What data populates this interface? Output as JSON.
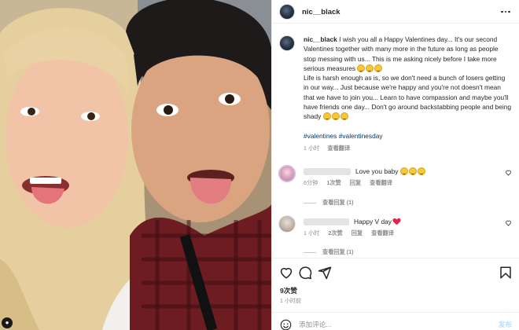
{
  "post": {
    "username": "nic__black",
    "caption": {
      "username": "nic__black",
      "paragraph1": "I wish you all a Happy Valentines day... It's our second Valentines together with many more in the future as long as people stop messing with us... This is me asking nicely before I take more serious measures",
      "paragraph2": "Life is harsh enough as is, so we don't need a bunch of losers getting in our way... Just because we're happy and you're not doesn't mean that we have to join you... Learn to have compassion and maybe you'll have friends one day... Don't go around backstabbing people and being shady",
      "hashtags": [
        "#valentines",
        "#valentinesday"
      ],
      "time": "1 小时",
      "translate": "查看翻译"
    },
    "comments": [
      {
        "text": "Love you baby",
        "emoji_count": 3,
        "time": "6分钟",
        "likes": "1次赞",
        "reply": "回复",
        "translate": "查看翻译",
        "replies": "查看回复 (1)"
      },
      {
        "text": "Happy V day",
        "time": "1 小时",
        "likes": "2次赞",
        "reply": "回复",
        "translate": "查看翻译",
        "replies": "查看回复 (1)"
      }
    ],
    "likes": "9次赞",
    "time_ago": "1 小时前",
    "add_comment_placeholder": "添加评论...",
    "post_button": "发布"
  },
  "colors": {
    "hashtag": "#00376b",
    "muted": "#8e8e8e",
    "post_button": "#b2dffc",
    "heart": "#e0244a"
  },
  "icons": [
    "more-icon",
    "heart-icon",
    "comment-icon",
    "share-icon",
    "bookmark-icon",
    "emoji-icon"
  ]
}
